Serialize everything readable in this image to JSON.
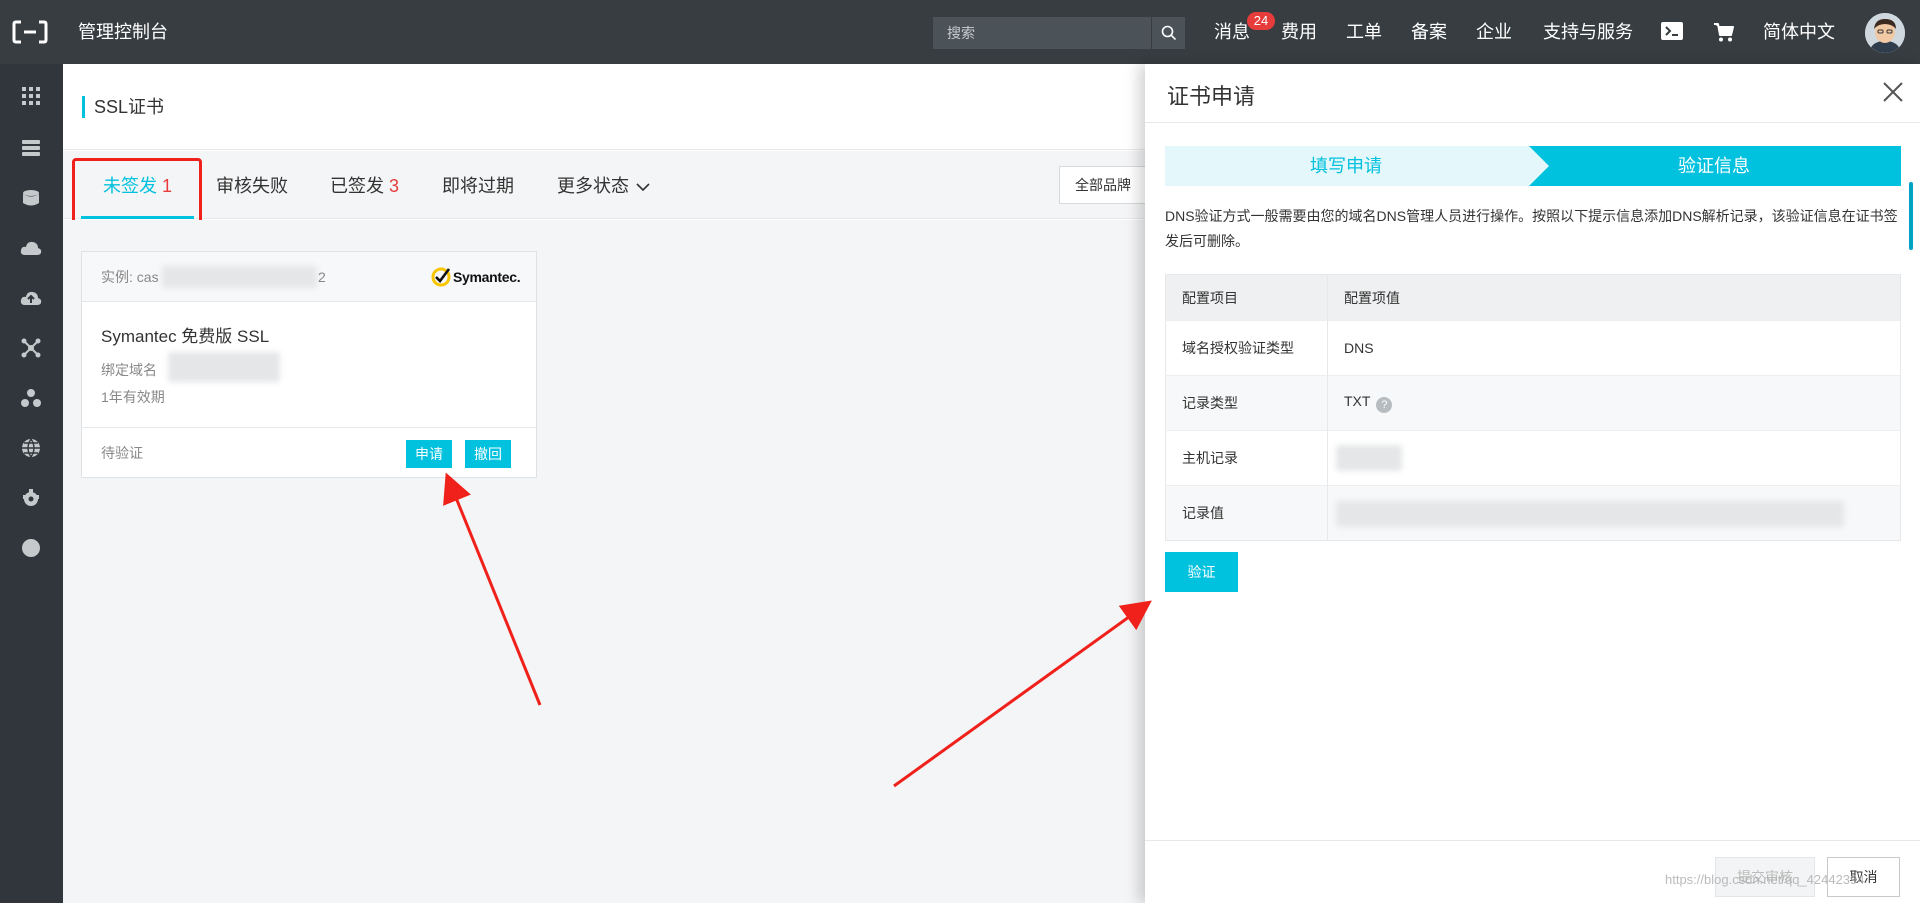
{
  "header": {
    "app_title": "管理控制台",
    "search_placeholder": "搜索",
    "nav": {
      "messages": "消息",
      "messages_count": "24",
      "fees": "费用",
      "tickets": "工单",
      "icp": "备案",
      "enterprise": "企业",
      "support": "支持与服务",
      "language": "简体中文"
    }
  },
  "sidebar": {
    "icons": [
      "grid-icon",
      "server-icon",
      "database-icon",
      "cloud-icon",
      "cloud-up-icon",
      "network-icon",
      "cluster-icon",
      "globe-icon",
      "settings-icon",
      "circle-icon"
    ]
  },
  "page": {
    "title": "SSL证书",
    "tabs": [
      {
        "label": "未签发",
        "count": "1"
      },
      {
        "label": "审核失败",
        "count": ""
      },
      {
        "label": "已签发",
        "count": "3"
      },
      {
        "label": "即将过期",
        "count": ""
      },
      {
        "label": "更多状态",
        "count": ""
      }
    ],
    "brand_filter": "全部品牌"
  },
  "card": {
    "instance_prefix": "实例: cas",
    "instance_suffix": "2",
    "brand_logo": "Symantec.",
    "name": "Symantec 免费版 SSL",
    "domain_label": "绑定域名",
    "validity": "1年有效期",
    "status": "待验证",
    "apply_label": "申请",
    "revoke_label": "撤回"
  },
  "drawer": {
    "title": "证书申请",
    "steps": [
      {
        "label": "填写申请"
      },
      {
        "label": "验证信息"
      }
    ],
    "description": "DNS验证方式一般需要由您的域名DNS管理人员进行操作。按照以下提示信息添加DNS解析记录，该验证信息在证书签发后可删除。",
    "table": {
      "headers": [
        "配置项目",
        "配置项值"
      ],
      "rows": [
        {
          "key": "域名授权验证类型",
          "value": "DNS"
        },
        {
          "key": "记录类型",
          "value": "TXT"
        },
        {
          "key": "主机记录",
          "value": ""
        },
        {
          "key": "记录值",
          "value": ""
        }
      ]
    },
    "verify_label": "验证",
    "submit_label": "提交审核",
    "cancel_label": "取消"
  },
  "watermark": "https://blog.csdn.net/qq_42442394",
  "colors": {
    "accent": "#00c1de",
    "topbar": "#373d41",
    "sidebar": "#30363b",
    "annotation": "#f0211b",
    "badge": "#e73c3c"
  }
}
